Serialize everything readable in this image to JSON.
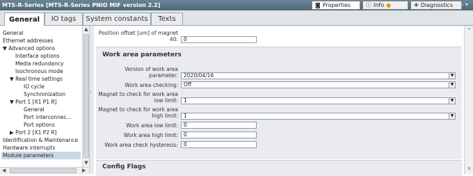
{
  "window": {
    "title": "MTS-R-Series [MTS-R-Series PNIO MIF version 2.2]",
    "buttons": {
      "properties": "Properties",
      "info": "Info",
      "diagnostics": "Diagnostics"
    }
  },
  "tabs": [
    "General",
    "IO tags",
    "System constants",
    "Texts"
  ],
  "tree": [
    "General",
    "Ethernet addresses",
    "▼ Advanced options",
    "Interface options",
    "Media redundancy",
    "Isochronous mode",
    "▼ Real time settings",
    "IO cycle",
    "Synchronization",
    "▼ Port 1 [X1 P1 R]",
    "General",
    "Port interconnec...",
    "Port options",
    "▶ Port 2 [X1 P2 R]",
    "Identification & Maintenance",
    "Hardware interrupts",
    "Module parameters"
  ],
  "top_param": {
    "label_line1": "Position offset [um] of magnet",
    "label_line2": "40:",
    "value": "0"
  },
  "work_area": {
    "title": "Work area parameters",
    "version_label_line1": "Version of work area",
    "version_label_line2": "parameter:",
    "version_value": "2020/04/16",
    "checking_label": "Work area checking:",
    "checking_value": "Off",
    "low_magnet_label_line1": "Magnet to check for work area",
    "low_magnet_label_line2": "low limit:",
    "low_magnet_value": "1",
    "high_magnet_label_line1": "Magnet to check for work area",
    "high_magnet_label_line2": "high limit:",
    "high_magnet_value": "1",
    "low_limit_label": "Work area low limit:",
    "low_limit_value": "0",
    "high_limit_label": "Work area high limit:",
    "high_limit_value": "0",
    "hysteresis_label": "Work area check hysteresis:",
    "hysteresis_value": "0"
  },
  "config_flags": {
    "title": "Config Flags"
  }
}
